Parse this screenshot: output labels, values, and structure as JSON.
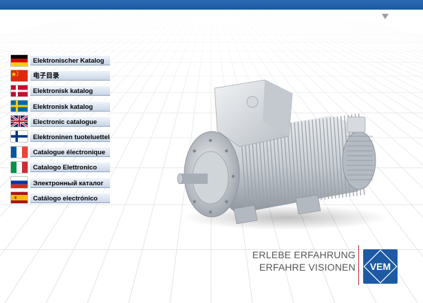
{
  "languages": [
    {
      "label": "Elektronischer Katalog",
      "flag": "germany-flag-icon"
    },
    {
      "label": "电子目录",
      "flag": "china-flag-icon"
    },
    {
      "label": "Elektronisk katalog",
      "flag": "denmark-flag-icon"
    },
    {
      "label": "Elektronisk katalog",
      "flag": "sweden-flag-icon"
    },
    {
      "label": "Electronic catalogue",
      "flag": "uk-flag-icon"
    },
    {
      "label": "Elektroninen tuoteluettelo",
      "flag": "finland-flag-icon"
    },
    {
      "label": "Catalogue électronique",
      "flag": "france-flag-icon"
    },
    {
      "label": "Catalogo Elettronico",
      "flag": "italy-flag-icon"
    },
    {
      "label": "Электронный каталог",
      "flag": "russia-flag-icon"
    },
    {
      "label": "Catálogo electrónico",
      "flag": "spain-flag-icon"
    }
  ],
  "slogan": {
    "line1": "ERLEBE ERFAHRUNG",
    "line2": "ERFAHRE VISIONEN"
  },
  "logo": {
    "text": "VEM"
  },
  "colors": {
    "brand_blue": "#1d5aa3",
    "accent_red": "#c0282d",
    "button_top": "#eef3fa",
    "button_bottom": "#c9d6e7"
  }
}
